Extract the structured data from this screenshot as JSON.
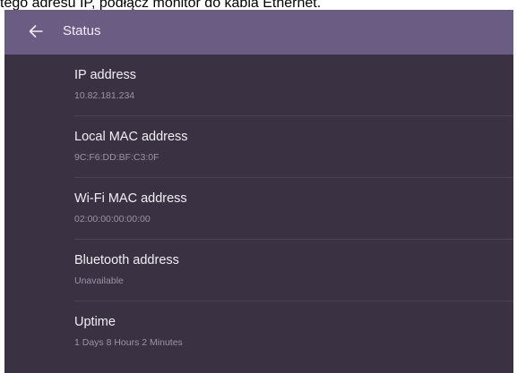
{
  "caption": "tego adresu IP, podłącz monitor do kabla Ethernet.",
  "header": {
    "back_icon": "arrow-left-icon",
    "title": "Status"
  },
  "items": [
    {
      "label": "IP address",
      "value": "10.82.181.234"
    },
    {
      "label": "Local MAC address",
      "value": "9C:F6:DD:BF:C3:0F"
    },
    {
      "label": "Wi-Fi MAC address",
      "value": "02:00:00:00:00:00"
    },
    {
      "label": "Bluetooth address",
      "value": "Unavailable"
    },
    {
      "label": "Uptime",
      "value": "1 Days 8 Hours 2 Minutes"
    }
  ],
  "colors": {
    "header_bg": "#6a5c82",
    "screen_bg": "#3a3142",
    "label_text": "#f1eef4",
    "value_text": "#9c95a6"
  }
}
